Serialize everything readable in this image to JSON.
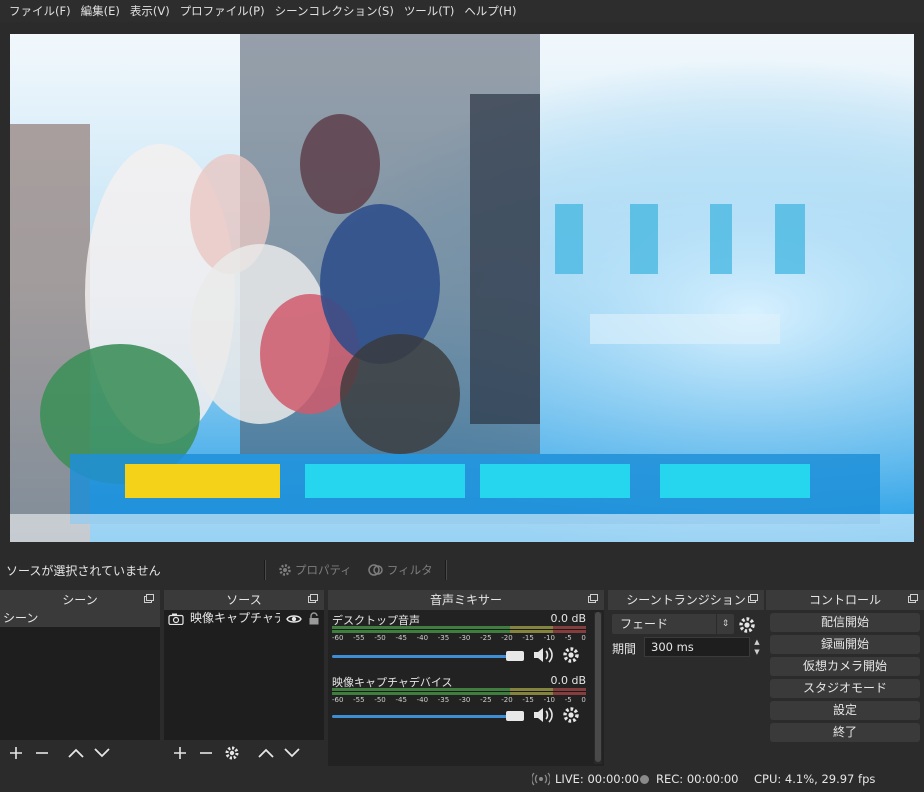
{
  "menu": [
    "ファイル(F)",
    "編集(E)",
    "表示(V)",
    "プロファイル(P)",
    "シーンコレクション(S)",
    "ツール(T)",
    "ヘルプ(H)"
  ],
  "toolbar": {
    "no_source": "ソースが選択されていません",
    "properties": "プロパティ",
    "filters": "フィルタ"
  },
  "scenes": {
    "title": "シーン",
    "items": [
      "シーン"
    ]
  },
  "sources": {
    "title": "ソース",
    "items": [
      {
        "name": "映像キャプチャデバ",
        "icon": "camera-icon"
      }
    ]
  },
  "mixer": {
    "title": "音声ミキサー",
    "ticks": [
      "-60",
      "-55",
      "-50",
      "-45",
      "-40",
      "-35",
      "-30",
      "-25",
      "-20",
      "-15",
      "-10",
      "-5",
      "0"
    ],
    "channels": [
      {
        "name": "デスクトップ音声",
        "db": "0.0 dB",
        "volume": 1.0
      },
      {
        "name": "映像キャプチャデバイス",
        "db": "0.0 dB",
        "volume": 1.0
      }
    ]
  },
  "transitions": {
    "title": "シーントランジション",
    "selected": "フェード",
    "duration_label": "期間",
    "duration_value": "300 ms"
  },
  "controls": {
    "title": "コントロール",
    "buttons": [
      "配信開始",
      "録画開始",
      "仮想カメラ開始",
      "スタジオモード",
      "設定",
      "終了"
    ]
  },
  "status": {
    "live": "LIVE: 00:00:00",
    "rec": "REC: 00:00:00",
    "cpu": "CPU: 4.1%, 29.97 fps"
  },
  "colors": {
    "accent": "#3e8ed6",
    "dock_title_bg": "#3a3a3a",
    "panel_bg": "#1e1e1e"
  }
}
